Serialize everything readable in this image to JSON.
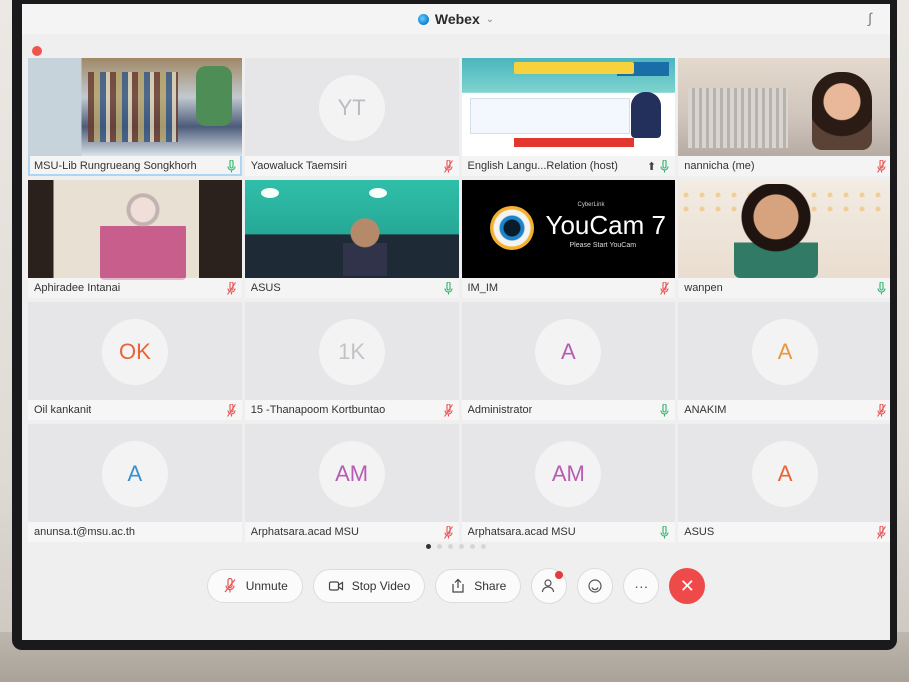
{
  "window": {
    "title": "Webex"
  },
  "participants": [
    {
      "name": "MSU-Lib Rungrueang Songkhorh",
      "initials": "",
      "mic": "on",
      "video": "lib"
    },
    {
      "name": "Yaowaluck Taemsiri",
      "initials": "YT",
      "mic": "muted",
      "avatar_color": "#b9bcc0"
    },
    {
      "name": "English Langu...Relation (host)",
      "initials": "",
      "mic": "on",
      "video": "banner",
      "sharing": true
    },
    {
      "name": "nannicha (me)",
      "initials": "",
      "mic": "muted",
      "video": "room"
    },
    {
      "name": "Aphiradee Intanai",
      "initials": "",
      "mic": "muted",
      "video": "office"
    },
    {
      "name": "ASUS",
      "initials": "",
      "mic": "on",
      "video": "asus"
    },
    {
      "name": "IM_IM",
      "initials": "",
      "mic": "muted",
      "video": "youcam"
    },
    {
      "name": "wanpen",
      "initials": "",
      "mic": "on",
      "video": "wanpen"
    },
    {
      "name": "Oil kankanit",
      "initials": "OK",
      "mic": "muted",
      "avatar_color": "#e8643a"
    },
    {
      "name": "15 -Thanapoom Kortbuntao",
      "initials": "1K",
      "mic": "muted",
      "avatar_color": "#c0c3c7"
    },
    {
      "name": "Administrator",
      "initials": "A",
      "mic": "on",
      "avatar_color": "#b65db3"
    },
    {
      "name": "ANAKIM",
      "initials": "A",
      "mic": "muted",
      "avatar_color": "#e8973a"
    },
    {
      "name": "anunsa.t@msu.ac.th",
      "initials": "A",
      "mic": "",
      "avatar_color": "#3a8fd1"
    },
    {
      "name": "Arphatsara.acad MSU",
      "initials": "AM",
      "mic": "muted",
      "avatar_color": "#b65db3"
    },
    {
      "name": "Arphatsara.acad MSU",
      "initials": "AM",
      "mic": "on",
      "avatar_color": "#b65db3"
    },
    {
      "name": "ASUS",
      "initials": "A",
      "mic": "muted",
      "avatar_color": "#e8643a"
    }
  ],
  "youcam": {
    "title": "YouCam 7",
    "brand": "CyberLink",
    "subtitle": "Please Start YouCam"
  },
  "pager": {
    "pages": 6,
    "active": 0
  },
  "toolbar": {
    "unmute_label": "Unmute",
    "stop_video_label": "Stop Video",
    "share_label": "Share",
    "more_label": "···",
    "end_label": "✕"
  },
  "colors": {
    "muted_red": "#e65454",
    "mic_green": "#2fb36a",
    "end_call": "#ee4a4a",
    "selected_outline": "#4aa3e8"
  }
}
